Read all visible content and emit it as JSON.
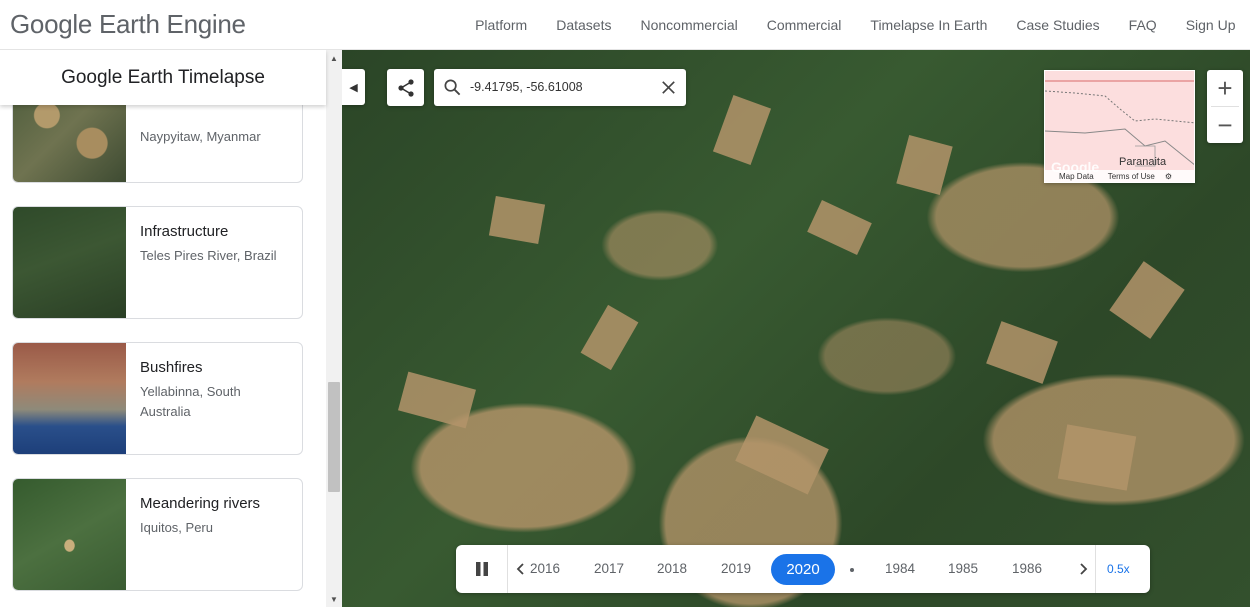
{
  "header": {
    "logo": "Google Earth Engine",
    "nav": [
      "Platform",
      "Datasets",
      "Noncommercial",
      "Commercial",
      "Timelapse In Earth",
      "Case Studies",
      "FAQ",
      "Sign Up"
    ]
  },
  "sidebar": {
    "title": "Google Earth Timelapse",
    "cards": [
      {
        "title": "",
        "subtitle": "Naypyitaw, Myanmar"
      },
      {
        "title": "Infrastructure",
        "subtitle": "Teles Pires River, Brazil"
      },
      {
        "title": "Bushfires",
        "subtitle": "Yellabinna, South Australia"
      },
      {
        "title": "Meandering rivers",
        "subtitle": "Iquitos, Peru"
      }
    ]
  },
  "map": {
    "search_value": "-9.41795, -56.61008",
    "minimap": {
      "place_label": "Paranaita",
      "footer": [
        "Map Data",
        "Terms of Use"
      ]
    },
    "zoom_in": "+",
    "zoom_out": "−"
  },
  "timeline": {
    "years_before": [
      "2016",
      "2017",
      "2018",
      "2019"
    ],
    "active_year": "2020",
    "years_after": [
      "1984",
      "1985",
      "1986"
    ],
    "speed": "0.5x"
  },
  "colors": {
    "accent": "#1a73e8",
    "text_secondary": "#5f6368"
  }
}
